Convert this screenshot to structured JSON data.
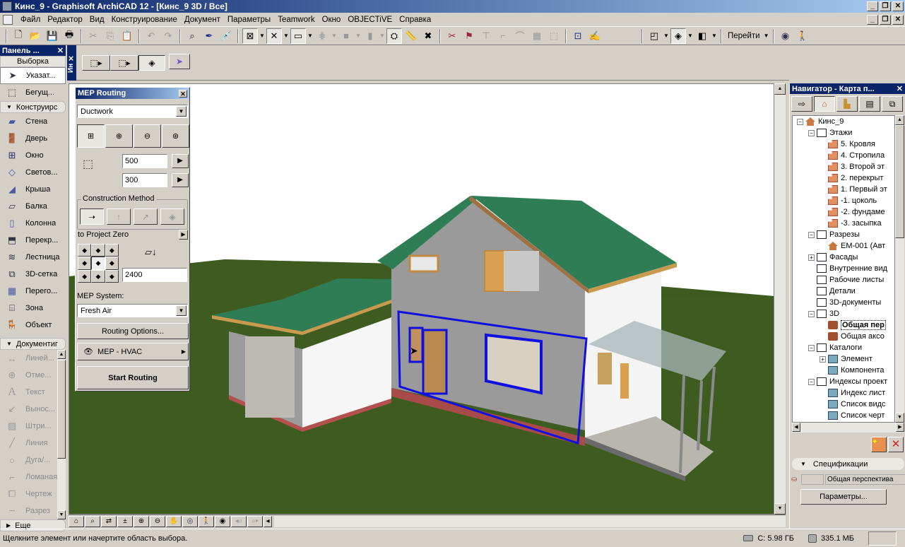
{
  "window": {
    "title": "Кинс_9 - Graphisoft ArchiCAD 12 - [Кинс_9 3D / Все]",
    "controls": {
      "minimize": "_",
      "maximize": "❐",
      "close": "✕"
    }
  },
  "menu": {
    "items": [
      "Файл",
      "Редактор",
      "Вид",
      "Конструирование",
      "Документ",
      "Параметры",
      "Teamwork",
      "Окно",
      "OBJECTiVE",
      "Справка"
    ]
  },
  "toolbar": {
    "goto_label": "Перейти",
    "icons": [
      "new-file-icon",
      "open-folder-icon",
      "save-icon",
      "print-icon",
      "cut-icon",
      "copy-icon",
      "paste-icon",
      "undo-icon",
      "redo-icon",
      "find-select-icon",
      "eyedropper-icon",
      "syringe-icon",
      "magic-wand-icon",
      "suspend-groups-icon",
      "marquee-icon",
      "grid-icon",
      "layer-icon",
      "pen-icon",
      "trace-icon",
      "ruler-icon",
      "cross-icon",
      "split-icon",
      "adjust-icon",
      "elevation-icon",
      "fillet-icon",
      "curve-icon",
      "align-icon",
      "distribute-icon",
      "transform-icon",
      "teamwork-icon",
      "plan-view-icon",
      "3d-view-icon",
      "layout-icon",
      "orbit-icon",
      "walk-icon"
    ]
  },
  "toolbox": {
    "title": "Панель ...",
    "selection_label": "Выборка",
    "select_tools": [
      {
        "label": "Указат...",
        "icon": "arrow-pointer-icon",
        "active": true
      },
      {
        "label": "Бегущ...",
        "icon": "marquee-icon",
        "active": false
      }
    ],
    "design_group": "Конструирс",
    "design_tools": [
      {
        "label": "Стена",
        "icon": "wall-icon"
      },
      {
        "label": "Дверь",
        "icon": "door-icon"
      },
      {
        "label": "Окно",
        "icon": "window-icon"
      },
      {
        "label": "Светов...",
        "icon": "skylight-icon"
      },
      {
        "label": "Крыша",
        "icon": "roof-icon"
      },
      {
        "label": "Балка",
        "icon": "beam-icon"
      },
      {
        "label": "Колонна",
        "icon": "column-icon"
      },
      {
        "label": "Перекр...",
        "icon": "slab-icon"
      },
      {
        "label": "Лестница",
        "icon": "stair-icon"
      },
      {
        "label": "3D-сетка",
        "icon": "mesh-icon"
      },
      {
        "label": "Перего...",
        "icon": "curtain-wall-icon"
      },
      {
        "label": "Зона",
        "icon": "zone-icon"
      },
      {
        "label": "Объект",
        "icon": "object-icon"
      }
    ],
    "document_group": "Документиг",
    "document_tools": [
      {
        "label": "Линей...",
        "icon": "dimension-icon"
      },
      {
        "label": "Отме...",
        "icon": "level-dimension-icon"
      },
      {
        "label": "Текст",
        "icon": "text-icon"
      },
      {
        "label": "Вынос...",
        "icon": "label-icon"
      },
      {
        "label": "Штри...",
        "icon": "fill-icon"
      },
      {
        "label": "Линия",
        "icon": "line-icon"
      },
      {
        "label": "Дуга/...",
        "icon": "arc-icon"
      },
      {
        "label": "Ломаная",
        "icon": "polyline-icon"
      },
      {
        "label": "Чертеж",
        "icon": "drawing-icon"
      },
      {
        "label": "Разрез",
        "icon": "section-icon"
      }
    ],
    "more_label": "Еще"
  },
  "infobox": {
    "title": "Ин"
  },
  "mep_routing": {
    "title": "MEP Routing",
    "type_select": "Ductwork",
    "width": "500",
    "height": "300",
    "construction_method_label": "Construction Method",
    "reference_label": "to Project Zero",
    "elevation": "2400",
    "system_label": "MEP System:",
    "system_select": "Fresh Air",
    "routing_options_label": "Routing Options...",
    "view_label": "MEP - HVAC",
    "start_label": "Start Routing"
  },
  "navigator": {
    "title": "Навигатор - Карта п...",
    "tree": [
      {
        "label": "Кинс_9",
        "level": 0,
        "exp": "−",
        "icon": "house"
      },
      {
        "label": "Этажи",
        "level": 1,
        "exp": "−",
        "icon": "box"
      },
      {
        "label": "5. Кровля",
        "level": 2,
        "icon": "story"
      },
      {
        "label": "4. Стропила",
        "level": 2,
        "icon": "story"
      },
      {
        "label": "3. Второй эт",
        "level": 2,
        "icon": "story"
      },
      {
        "label": "2. перекрыт",
        "level": 2,
        "icon": "story"
      },
      {
        "label": "1. Первый эт",
        "level": 2,
        "icon": "story"
      },
      {
        "label": "-1. цоколь",
        "level": 2,
        "icon": "story"
      },
      {
        "label": "-2. фундаме",
        "level": 2,
        "icon": "story"
      },
      {
        "label": "-3. засыпка",
        "level": 2,
        "icon": "story"
      },
      {
        "label": "Разрезы",
        "level": 1,
        "exp": "−",
        "icon": "box"
      },
      {
        "label": "EM-001 (Авт",
        "level": 2,
        "icon": "house"
      },
      {
        "label": "Фасады",
        "level": 1,
        "exp": "+",
        "icon": "box"
      },
      {
        "label": "Внутренние вид",
        "level": 1,
        "icon": "box"
      },
      {
        "label": "Рабочие листы",
        "level": 1,
        "icon": "box"
      },
      {
        "label": "Детали",
        "level": 1,
        "icon": "box"
      },
      {
        "label": "3D-документы",
        "level": 1,
        "icon": "box"
      },
      {
        "label": "3D",
        "level": 1,
        "exp": "−",
        "icon": "box"
      },
      {
        "label": "Общая пер",
        "level": 2,
        "icon": "cam",
        "selected": true
      },
      {
        "label": "Общая аксо",
        "level": 2,
        "icon": "cam"
      },
      {
        "label": "Каталоги",
        "level": 1,
        "exp": "−",
        "icon": "box"
      },
      {
        "label": "Элемент",
        "level": 2,
        "exp": "+",
        "icon": "sheet"
      },
      {
        "label": "Компонента",
        "level": 2,
        "icon": "sheet"
      },
      {
        "label": "Индексы проект",
        "level": 1,
        "exp": "−",
        "icon": "box"
      },
      {
        "label": "Индекс лист",
        "level": 2,
        "icon": "sheet"
      },
      {
        "label": "Список видс",
        "level": 2,
        "icon": "sheet"
      },
      {
        "label": "Список черт",
        "level": 2,
        "icon": "sheet"
      }
    ],
    "spec_label": "Спецификации",
    "view_name": "Общая перспектива",
    "params_label": "Параметры..."
  },
  "statusbar": {
    "message": "Щелкните элемент или начертите область выбора.",
    "disk": "C: 5.98 ГБ",
    "memory": "335.1 МБ"
  },
  "colors": {
    "titlebar_start": "#0a246a",
    "titlebar_end": "#a6caf0",
    "selection_outline": "#1010e0",
    "roof": "#2e7d55",
    "grass": "#3f5a22"
  }
}
